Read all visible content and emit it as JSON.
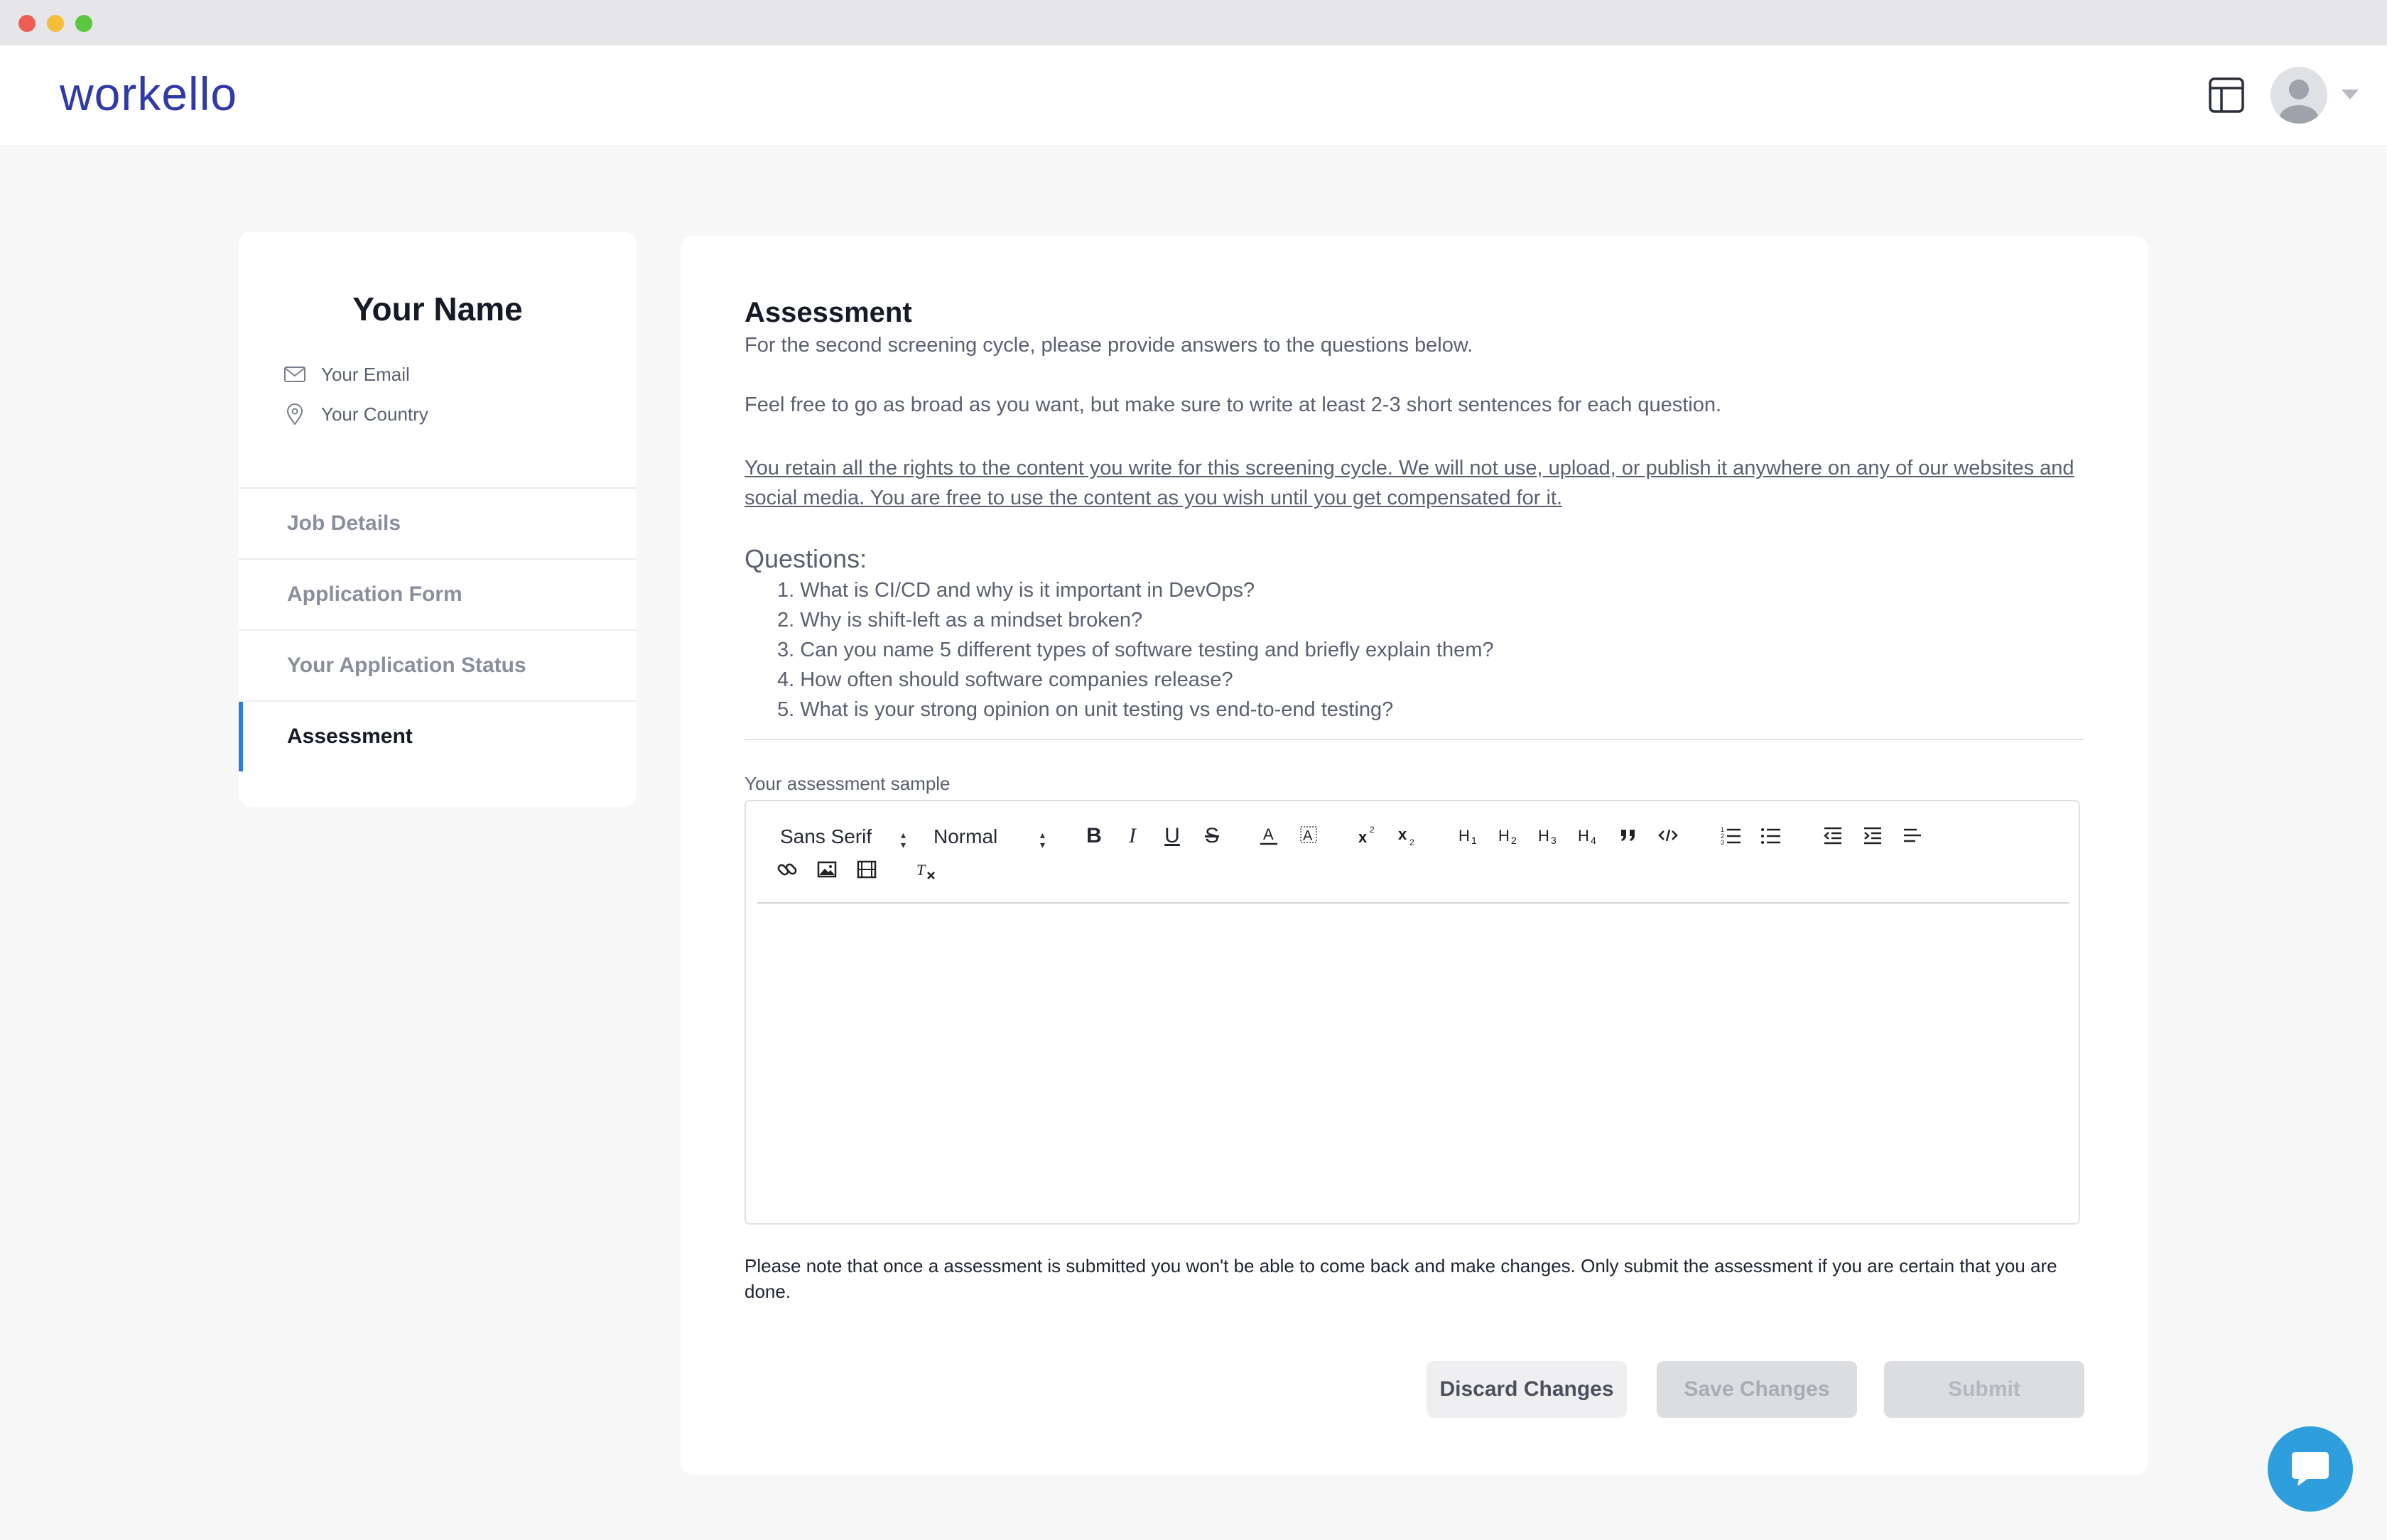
{
  "header": {
    "logo": "workello"
  },
  "profile": {
    "name": "Your Name",
    "email": "Your Email",
    "country": "Your Country"
  },
  "nav": {
    "items": [
      {
        "label": "Job Details"
      },
      {
        "label": "Application Form"
      },
      {
        "label": "Your Application Status"
      },
      {
        "label": "Assessment"
      }
    ],
    "active": "Assessment"
  },
  "assessment": {
    "title": "Assessment",
    "intro": "For the second screening cycle, please provide answers to the questions below.",
    "freedom": "Feel free to go as broad as you want, but make sure to write at least 2-3 short sentences for each question.",
    "rights": "You retain all the rights to the content you write for this screening cycle. We will not use, upload, or publish it anywhere on any of our websites and social media. You are free to use the content as you wish until you get compensated for it.",
    "questions_heading": "Questions:",
    "questions": [
      "1. What is CI/CD and why is it important in DevOps?",
      "2. Why is shift-left as a mindset broken?",
      "3. Can you name 5 different types of software testing and briefly explain them?",
      "4. How often should software companies release?",
      "5. What is your strong opinion on unit testing vs end-to-end testing?"
    ],
    "sample_label": "Your assessment sample",
    "editor": {
      "font_select": "Sans Serif",
      "size_select": "Normal",
      "content": ""
    },
    "note": "Please note that once a assessment is submitted you won't be able to come back and make changes. Only submit the assessment if you are certain that you are done.",
    "buttons": {
      "discard": "Discard Changes",
      "save": "Save Changes",
      "submit": "Submit"
    }
  },
  "colors": {
    "brand": "#2f3aa8",
    "active_indicator": "#2a7de8",
    "chat_bubble": "#2e9fdc"
  },
  "icons": [
    "layout-icon",
    "avatar",
    "mail-icon",
    "location-pin-icon",
    "chat-icon"
  ]
}
